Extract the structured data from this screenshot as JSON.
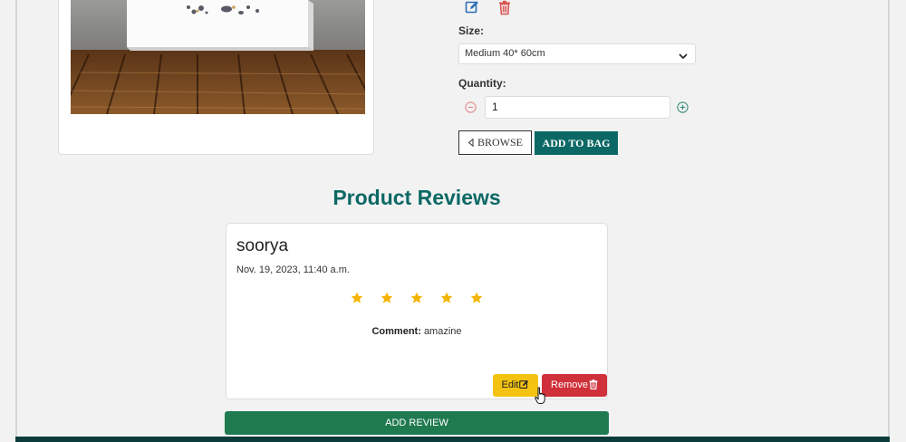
{
  "product": {
    "image_alt": "Canvas art print on wooden floor"
  },
  "admin": {
    "edit_icon": "edit-icon",
    "delete_icon": "trash-icon"
  },
  "size": {
    "label": "Size:",
    "selected": "Medium 40* 60cm"
  },
  "quantity": {
    "label": "Quantity:",
    "value": "1"
  },
  "buttons": {
    "browse": "BROWSE",
    "add_to_bag": "ADD TO BAG",
    "add_review": "ADD REVIEW"
  },
  "reviews": {
    "title": "Product Reviews",
    "items": [
      {
        "author": "soorya",
        "date": "Nov. 19, 2023, 11:40 a.m.",
        "rating": 5,
        "comment_label": "Comment:",
        "comment": "amazine",
        "edit_label": "Edit",
        "remove_label": "Remove"
      }
    ]
  },
  "colors": {
    "brand_teal": "#0c6865",
    "star": "#f4b400",
    "edit": "#f4c312",
    "remove": "#cf3039",
    "add_review": "#1f7a4f"
  }
}
